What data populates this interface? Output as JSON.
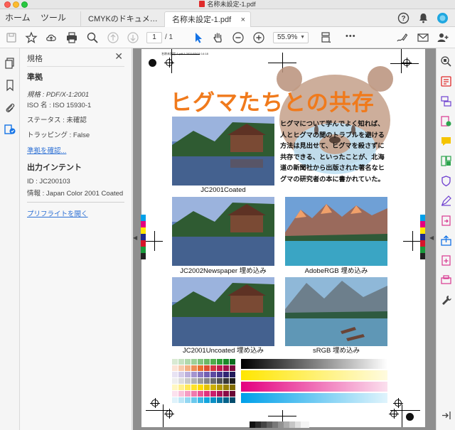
{
  "window": {
    "title": "名称未設定-1.pdf"
  },
  "tabbar": {
    "home": "ホーム",
    "tools": "ツール",
    "tabs": [
      {
        "label": "CMYKのドキュメ…"
      },
      {
        "label": "名称未設定-1.pdf",
        "close": "×"
      }
    ]
  },
  "toolbar": {
    "page_current": "1",
    "page_total": "/ 1",
    "zoom": "55.9%",
    "more": "•••"
  },
  "panel": {
    "title": "規格",
    "close": "✕",
    "compliance_heading": "準拠",
    "standard_line": "規格 : PDF/X-1:2001",
    "iso_line": "ISO 名 : ISO 15930-1",
    "status_line": "ステータス : 未確認",
    "trapping_line": "トラッピング : False",
    "verify_link": "準拠を確認...",
    "output_intent_heading": "出力インテント",
    "id_line": "ID : JC200103",
    "info_line": "情報 : Japan Color 2001 Coated",
    "preflight_link": "プリフライトを開く"
  },
  "document": {
    "slug": "名称未設定-1.pdf  1  2021/03/15  14:18",
    "headline": "ヒグマたちとの共存",
    "body": "ヒグマについて学んでよく知れば、人とヒグマの間のトラブルを避ける方法は見出せて、ヒグマを殺さずに共存できる、といったことが、北海道の新聞社から出版された著名なヒグマの研究者の本に書かれていた。",
    "captions": [
      "JC2001Coated",
      "JC2002Newspaper 埋め込み",
      "AdobeRGB 埋め込み",
      "JC2001Uncoated 埋め込み",
      "sRGB 埋め込み"
    ]
  },
  "colors": {
    "accent": "#f07a1c",
    "link": "#2b6fd4",
    "acrobat_red": "#e02b2b"
  }
}
